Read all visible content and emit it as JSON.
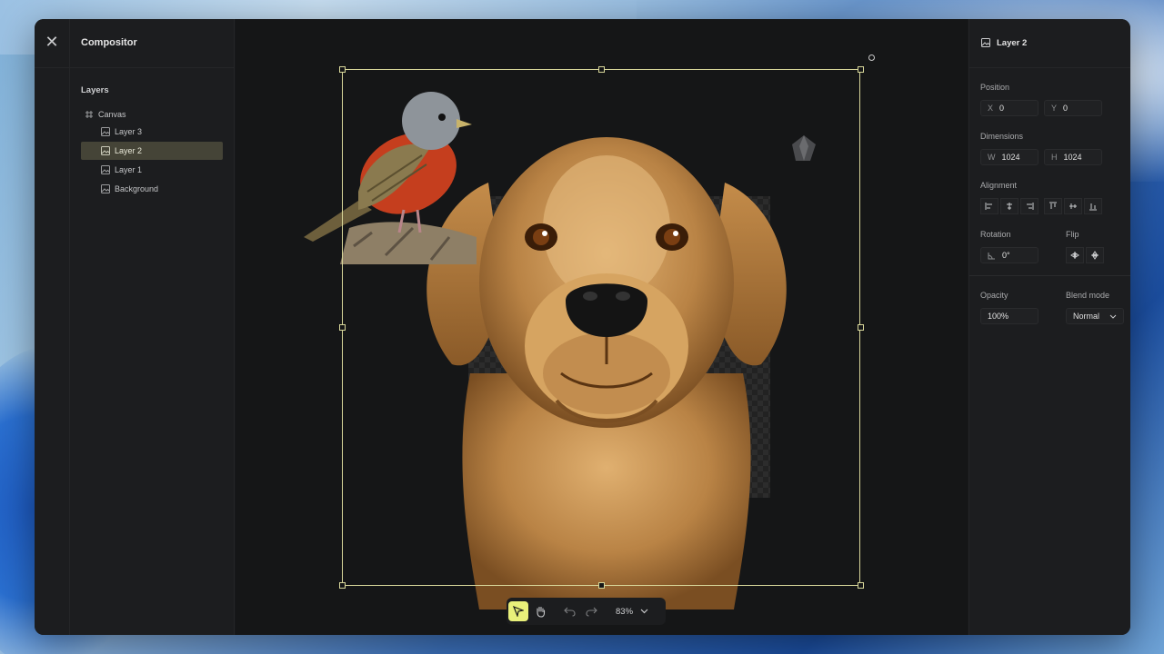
{
  "app": {
    "title": "Compositor"
  },
  "layers": {
    "heading": "Layers",
    "items": [
      {
        "label": "Canvas",
        "type": "canvas"
      },
      {
        "label": "Layer 3",
        "type": "image"
      },
      {
        "label": "Layer 2",
        "type": "image",
        "selected": true
      },
      {
        "label": "Layer 1",
        "type": "image"
      },
      {
        "label": "Background",
        "type": "image"
      }
    ]
  },
  "toolbar": {
    "tools": [
      {
        "name": "select-tool",
        "icon": "cursor-icon",
        "active": true
      },
      {
        "name": "pan-tool",
        "icon": "hand-icon",
        "active": false
      },
      {
        "name": "undo",
        "icon": "undo-icon",
        "active": false
      },
      {
        "name": "redo",
        "icon": "redo-icon",
        "active": false
      }
    ],
    "zoom": "83%"
  },
  "inspector": {
    "title": "Layer 2",
    "position": {
      "label": "Position",
      "x_prefix": "X",
      "x": "0",
      "y_prefix": "Y",
      "y": "0"
    },
    "dimensions": {
      "label": "Dimensions",
      "w_prefix": "W",
      "w": "1024",
      "h_prefix": "H",
      "h": "1024"
    },
    "alignment": {
      "label": "Alignment"
    },
    "rotation": {
      "label": "Rotation",
      "value": "0°"
    },
    "flip": {
      "label": "Flip"
    },
    "opacity": {
      "label": "Opacity",
      "value": "100%"
    },
    "blend": {
      "label": "Blend mode",
      "value": "Normal"
    }
  },
  "colors": {
    "accent": "#e9f07a",
    "selection": "#d8d79a",
    "selected_row": "#454437"
  }
}
